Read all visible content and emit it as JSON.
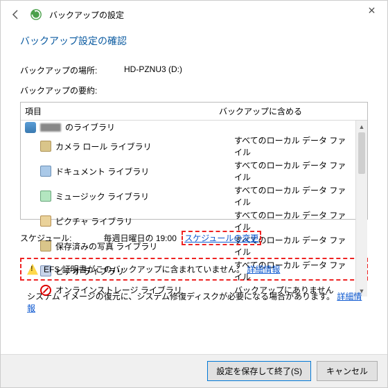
{
  "window": {
    "title": "バックアップの設定"
  },
  "page": {
    "title": "バックアップ設定の確認"
  },
  "location": {
    "label": "バックアップの場所:",
    "value": "HD-PZNU3 (D:)"
  },
  "summary": {
    "label": "バックアップの要約:"
  },
  "table": {
    "col1": "項目",
    "col2": "バックアップに含める",
    "inc_all": "すべてのローカル データ ファイル",
    "inc_no": "バックアップにありません",
    "rows": {
      "user_suffix": "のライブラリ",
      "camera": "カメラ ロール ライブラリ",
      "document": "ドキュメント ライブラリ",
      "music": "ミュージック ライブラリ",
      "picture": "ピクチャ ライブラリ",
      "saved": "保存済みの写真 ライブラリ",
      "video": "ビデオ ライブラリ",
      "online": "オンラインストレージ ライブラリ"
    }
  },
  "schedule": {
    "label": "スケジュール:",
    "value": "毎週日曜日の 19:00",
    "change_link": "スケジュールの変更"
  },
  "efs": {
    "text": "EFS 証明書がこのバックアップに含まれていません。",
    "link": "詳細情報"
  },
  "sysimage": {
    "text": "システム イメージの復元に、システム修復ディスクが必要になる場合があります。",
    "link": "詳細情報"
  },
  "buttons": {
    "save": "設定を保存して終了(S)",
    "cancel": "キャンセル"
  }
}
